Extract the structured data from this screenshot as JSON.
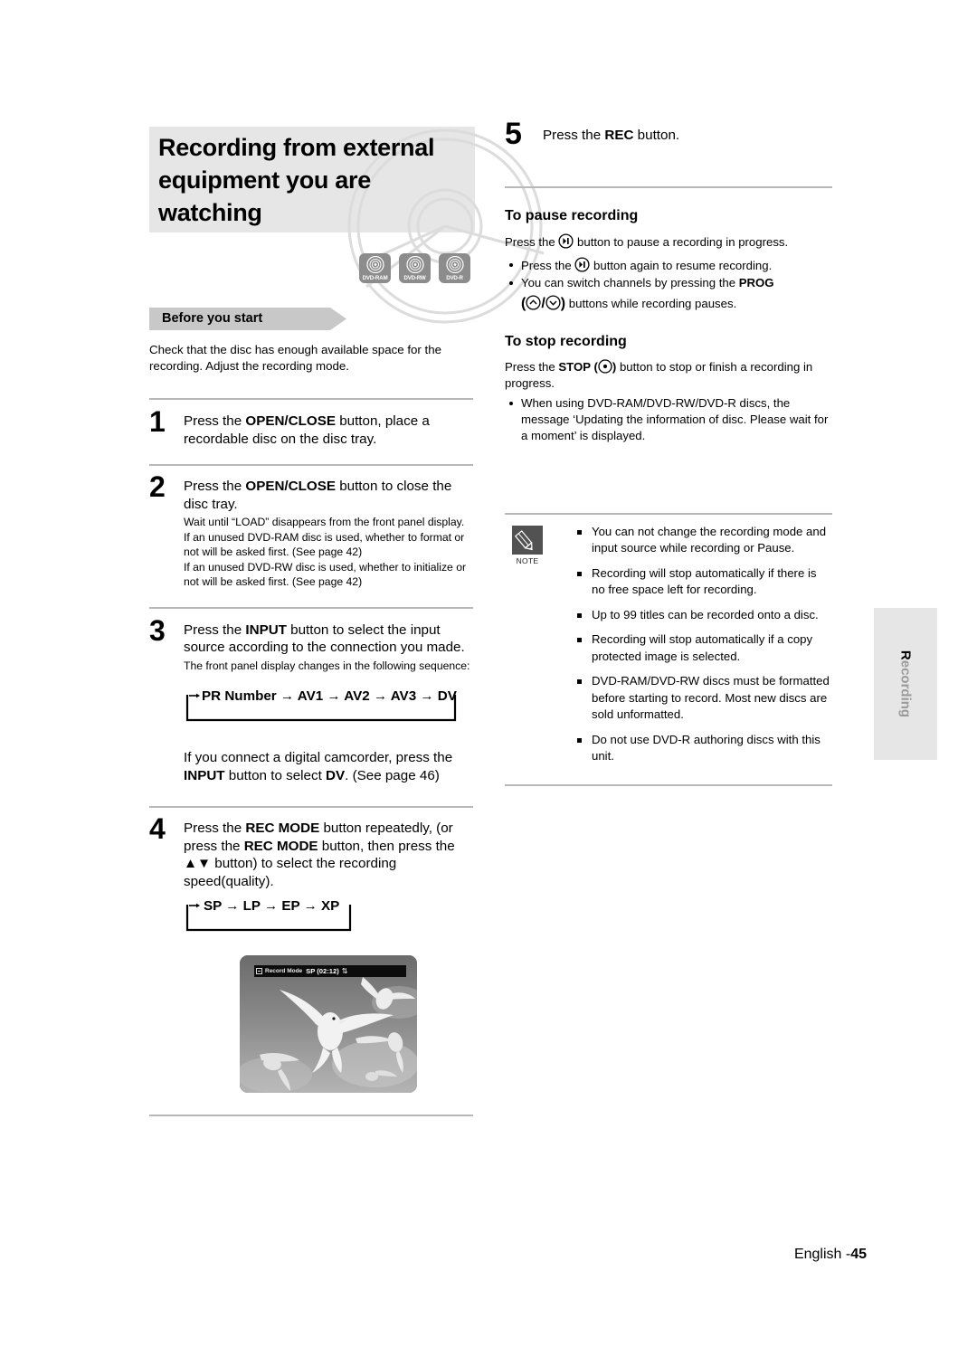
{
  "page": {
    "footer_label": "English -",
    "footer_page": "45",
    "side_tab_first": "R",
    "side_tab_rest": "ecording"
  },
  "header": {
    "title_line1": "Recording from external",
    "title_line2": "equipment you are",
    "title_line3": "watching",
    "disc_badges": [
      {
        "label": "DVD-RAM"
      },
      {
        "label": "DVD-RW"
      },
      {
        "label": "DVD-R"
      }
    ]
  },
  "before_you_start": {
    "banner": "Before you start",
    "body": "Check that the disc has enough available space for the recording. Adjust the recording mode."
  },
  "steps": [
    {
      "number": "1",
      "main_pre": "Press the ",
      "main_bold": "OPEN/CLOSE",
      "main_post": " button, place a recordable disc on the disc tray."
    },
    {
      "number": "2",
      "main_pre": "Press the ",
      "main_bold": "OPEN/CLOSE",
      "main_post": " button to close the disc tray.",
      "sub_lines": [
        "Wait until “LOAD” disappears from the front panel display.",
        "If an unused DVD-RAM disc is used, whether to format or not will be asked first. (See page 42)",
        "If an unused DVD-RW disc is used, whether to initialize or not will be asked first. (See page 42)"
      ]
    },
    {
      "number": "3",
      "main_pre": "Press the ",
      "main_bold": "INPUT",
      "main_post": " button to select the input source according to the connection you made.",
      "sub_lines": [
        "The front panel display changes in the following sequence:"
      ],
      "sequence": "PR Number → AV1 → AV2 → AV3 → DV",
      "note_pre": "If you connect a digital camcorder, press the ",
      "note_bold1": "INPUT",
      "note_mid": " button to select ",
      "note_bold2": "DV",
      "note_post": ". (See page 46)"
    },
    {
      "number": "4",
      "main_pre": "Press the ",
      "main_bold": "REC MODE",
      "main_mid": " button repeatedly, (or press the ",
      "main_bold2": "REC MODE",
      "main_post": " button, then press the ▲▼ button) to select the recording speed(quality).",
      "sequence": "SP → LP → EP → XP"
    },
    {
      "number": "5",
      "main_pre": "Press the ",
      "main_bold": "REC",
      "main_post": " button."
    }
  ],
  "screenshot": {
    "osd_label": "Record Mode",
    "osd_value": "SP (02:12)",
    "osd_arrows": "⇅"
  },
  "pause_section": {
    "heading": "To pause recording",
    "intro_pre": "Press the ",
    "intro_post": " button to pause a recording in progress.",
    "bullets": [
      {
        "pre": "Press the ",
        "icon": "pause-icon",
        "post": " button again to resume recording."
      },
      {
        "pre": "You can switch channels by pressing the ",
        "bold": "PROG",
        "post": " buttons while recording pauses.",
        "icons": "( ∧ / ∨ )"
      }
    ]
  },
  "stop_section": {
    "heading": "To stop recording",
    "intro_pre": "Press the ",
    "intro_bold": "STOP",
    "intro_paren_open": "(",
    "intro_paren_close": ")",
    "intro_post": " button to stop or finish a recording in progress.",
    "bullets": [
      "When using DVD-RAM/DVD-RW/DVD-R discs, the message ‘Updating the information of disc. Please wait for a moment’ is displayed."
    ]
  },
  "note_box": {
    "icon_label": "NOTE",
    "items": [
      "You can not change the recording mode and input source while recording or Pause.",
      "Recording will stop automatically if there is no free space left for recording.",
      "Up to 99 titles can be recorded onto a disc.",
      "Recording will stop automatically if a copy protected image is selected.",
      "DVD-RAM/DVD-RW discs must be formatted before starting to record. Most new discs are sold unformatted.",
      "Do not use DVD-R authoring discs with this unit."
    ]
  },
  "colors": {
    "band_gray": "#e6e6e6",
    "badge_gray": "#8c8c8c",
    "rule_gray": "#b8b8b8",
    "note_icon_gray": "#525252",
    "tab_text_gray": "#9a9a9a"
  }
}
